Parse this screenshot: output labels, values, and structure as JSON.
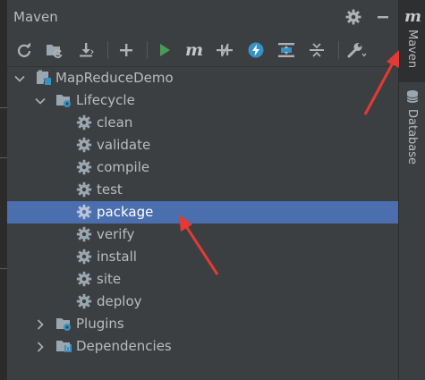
{
  "panel": {
    "title": "Maven"
  },
  "titlebar": {
    "settings_icon": "gear-icon",
    "minimize_icon": "minimize-icon"
  },
  "toolbar": {
    "icons": [
      "reload-all-icon",
      "generate-sources-icon",
      "download-icon",
      "add-project-icon",
      "run-icon",
      "maven-goal-icon",
      "toggle-offline-icon",
      "skip-tests-icon",
      "show-dependencies-icon",
      "collapse-all-icon",
      "settings-wrench-icon"
    ],
    "maven_goal_label": "m"
  },
  "tree": {
    "project": "MapReduceDemo",
    "lifecycle": {
      "label": "Lifecycle",
      "goals": [
        "clean",
        "validate",
        "compile",
        "test",
        "package",
        "verify",
        "install",
        "site",
        "deploy"
      ],
      "selected": "package"
    },
    "plugins": "Plugins",
    "dependencies": "Dependencies"
  },
  "right_sidebar": {
    "maven_icon_label": "m",
    "maven_tab": "Maven",
    "database_tab": "Database"
  },
  "colors": {
    "panel_bg": "#3c3f41",
    "selection": "#4b6eaf",
    "text": "#bbbbbb",
    "run_green": "#499c54",
    "accent_blue": "#3592c4",
    "annotation_red": "#e53935"
  }
}
